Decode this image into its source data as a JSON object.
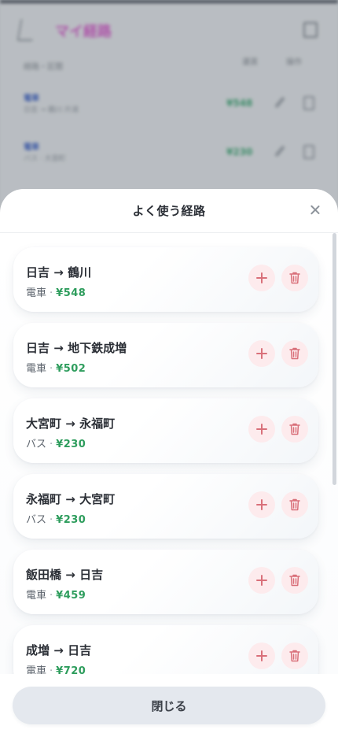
{
  "background": {
    "title": "マイ経路",
    "column_left": "経路・区間",
    "column_amount": "運賃",
    "column_actions": "操作",
    "rows": [
      {
        "tag": "電車",
        "sub": "日吉 → 鶴川 片道",
        "amount": "¥548"
      },
      {
        "tag": "電車",
        "sub": "バス · 大宮町",
        "amount": "¥230"
      }
    ]
  },
  "sheet": {
    "title": "よく使う経路",
    "close_label": "閉じる"
  },
  "routes": [
    {
      "from": "日吉",
      "arrow": "→",
      "to": "鶴川",
      "mode": "電車",
      "separator": "·",
      "fare": "¥548"
    },
    {
      "from": "日吉",
      "arrow": "→",
      "to": "地下鉄成増",
      "mode": "電車",
      "separator": "·",
      "fare": "¥502"
    },
    {
      "from": "大宮町",
      "arrow": "→",
      "to": "永福町",
      "mode": "バス",
      "separator": "·",
      "fare": "¥230"
    },
    {
      "from": "永福町",
      "arrow": "→",
      "to": "大宮町",
      "mode": "バス",
      "separator": "·",
      "fare": "¥230"
    },
    {
      "from": "飯田橋",
      "arrow": "→",
      "to": "日吉",
      "mode": "電車",
      "separator": "·",
      "fare": "¥459"
    },
    {
      "from": "成増",
      "arrow": "→",
      "to": "日吉",
      "mode": "電車",
      "separator": "·",
      "fare": "¥720"
    }
  ],
  "colors": {
    "fare_green": "#2e9d5d",
    "action_pink": "#fdebed",
    "action_icon": "#d9707a"
  },
  "icons": {
    "add": "plus-icon",
    "delete": "trash-icon",
    "close": "close-icon"
  }
}
